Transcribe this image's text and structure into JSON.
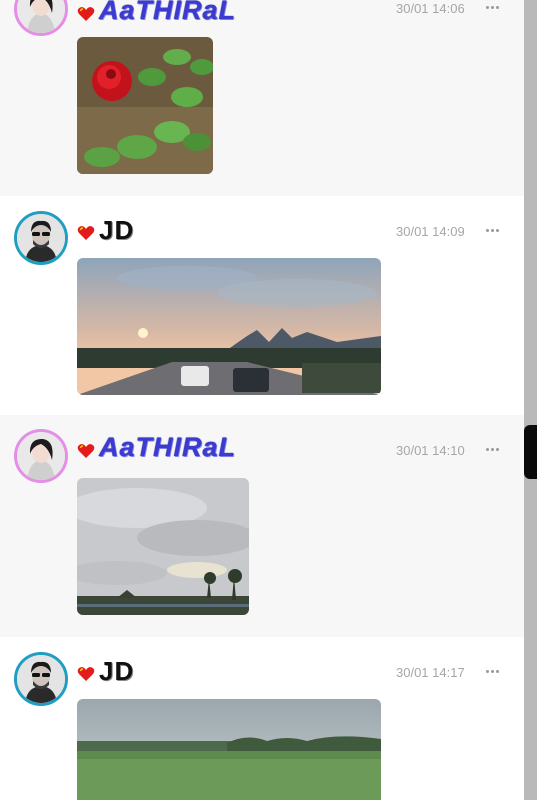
{
  "posts": [
    {
      "author": "AaTHIRaL",
      "time": "30/01 14:06",
      "avatar_icon": "woman-portrait-avatar",
      "image": "red-rose-plant-photo"
    },
    {
      "author": "JD",
      "time": "30/01 14:09",
      "avatar_icon": "man-portrait-avatar",
      "image": "sunset-highway-photo"
    },
    {
      "author": "AaTHIRaL",
      "time": "30/01 14:10",
      "avatar_icon": "woman-portrait-avatar",
      "image": "cloudy-sky-photo"
    },
    {
      "author": "JD",
      "time": "30/01 14:17",
      "avatar_icon": "man-portrait-avatar",
      "image": "green-field-photo"
    }
  ],
  "colors": {
    "accent_pink": "#e58ee8",
    "accent_blue": "#1f9ec4",
    "name_blue": "#3b3ad1",
    "timestamp": "#a6a6a6"
  }
}
